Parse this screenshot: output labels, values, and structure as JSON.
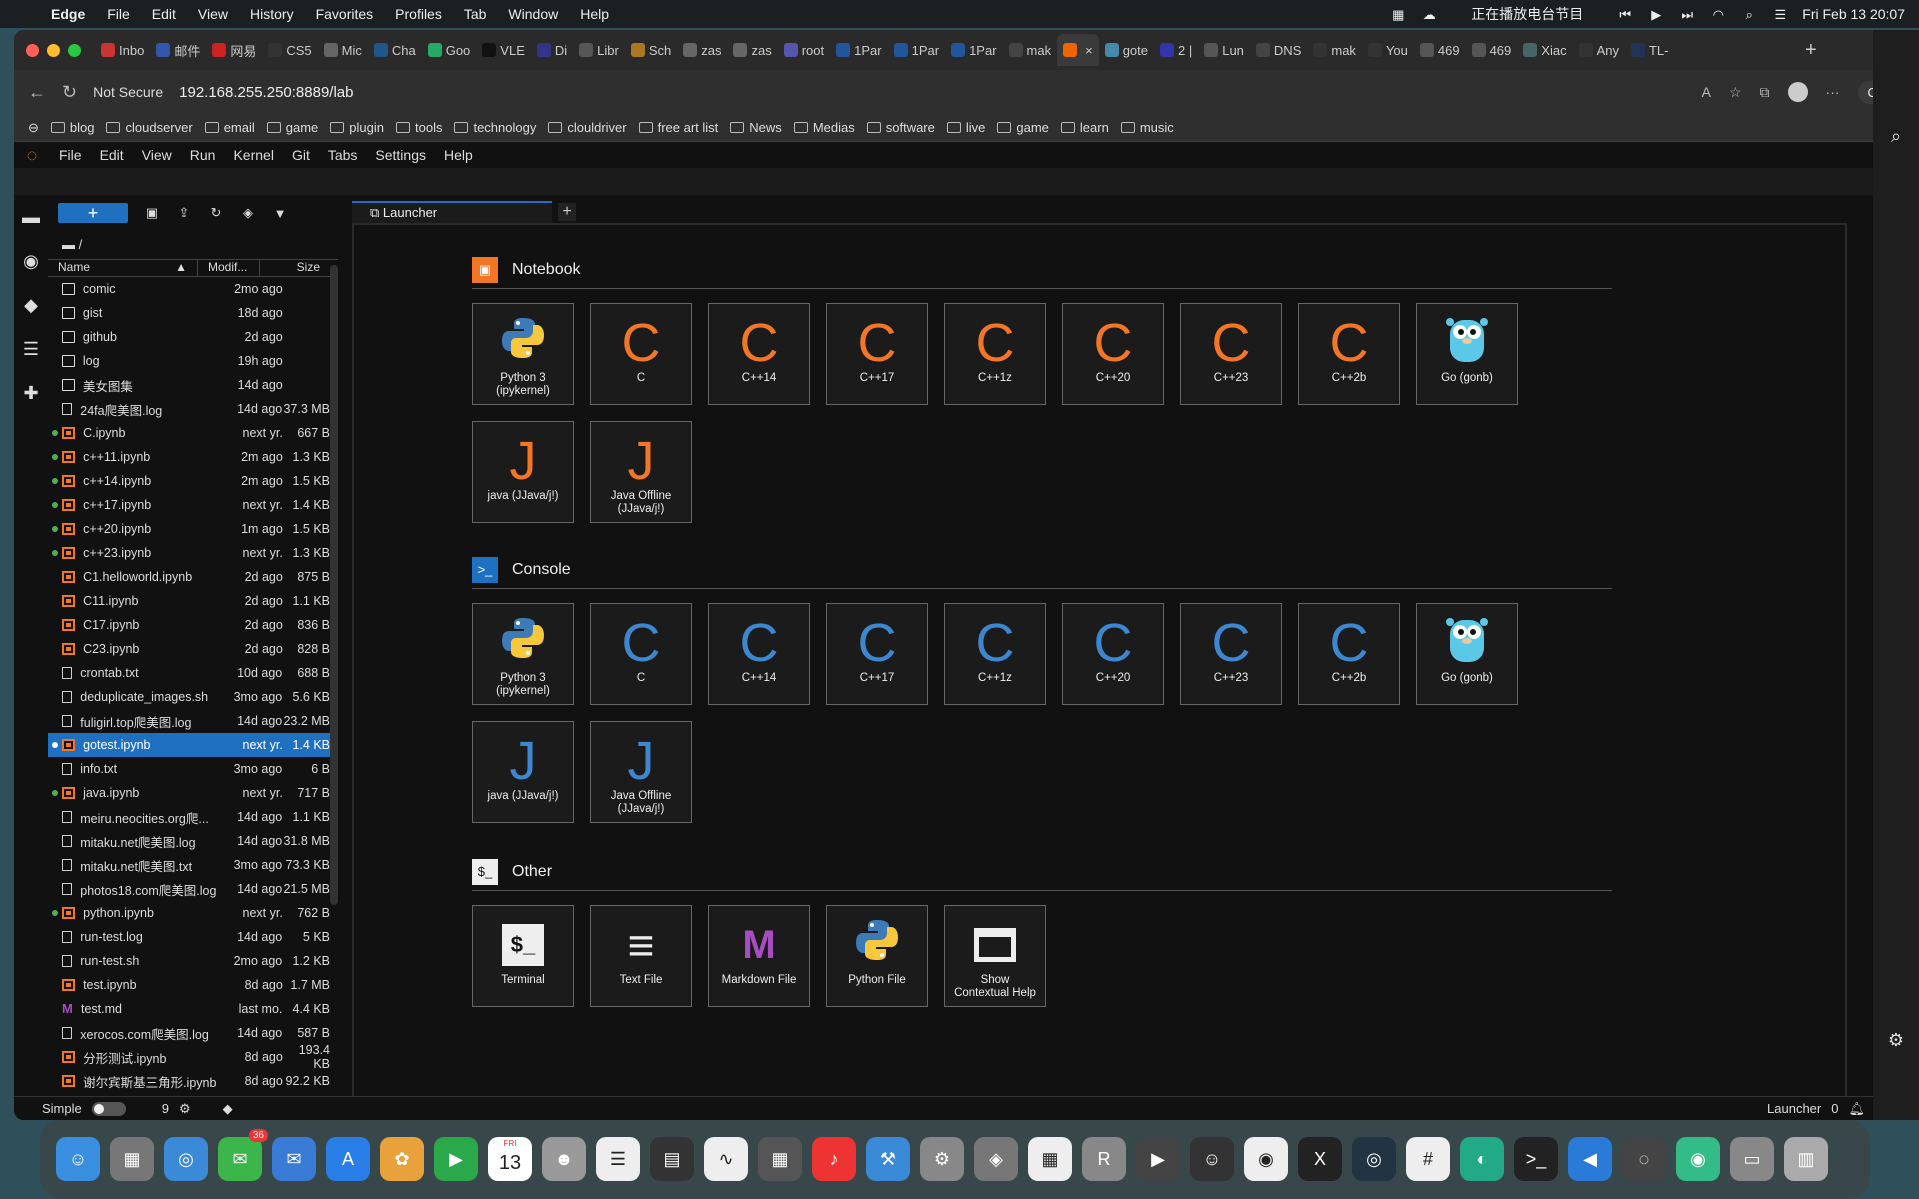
{
  "menubar": {
    "app": "Edge",
    "items": [
      "File",
      "Edit",
      "View",
      "History",
      "Favorites",
      "Profiles",
      "Tab",
      "Window",
      "Help"
    ],
    "now_playing": "正在播放电台节目",
    "datetime": "Fri Feb 13  20:07"
  },
  "browser_tabs": [
    "Inbo",
    "邮件",
    "网易",
    "CS5",
    "Mic",
    "Cha",
    "Goo",
    "VLE",
    "Di",
    "Libr",
    "Sch",
    "zas",
    "zas",
    "root",
    "1Par",
    "1Par",
    "1Par",
    "mak",
    "",
    "gote",
    "2 |",
    "Lun",
    "DNS",
    "mak",
    "You",
    "469",
    "469",
    "Xiac",
    "Any",
    "TL-"
  ],
  "address": {
    "security": "Not Secure",
    "url": "192.168.255.250:8889/lab",
    "chat_label": "Chat"
  },
  "bookmarks": [
    "blog",
    "cloudserver",
    "email",
    "game",
    "plugin",
    "tools",
    "technology",
    "clouldriver",
    "free art list",
    "News",
    "Medias",
    "software",
    "live",
    "game",
    "learn",
    "music"
  ],
  "jupyter_menu": [
    "File",
    "Edit",
    "View",
    "Run",
    "Kernel",
    "Git",
    "Tabs",
    "Settings",
    "Help"
  ],
  "file_browser": {
    "path": "/",
    "columns": {
      "name": "Name",
      "modified": "Modif...",
      "size": "Size"
    },
    "files": [
      {
        "name": "comic",
        "mod": "2mo ago",
        "size": "",
        "type": "folder",
        "running": false
      },
      {
        "name": "gist",
        "mod": "18d ago",
        "size": "",
        "type": "folder",
        "running": false
      },
      {
        "name": "github",
        "mod": "2d ago",
        "size": "",
        "type": "folder",
        "running": false
      },
      {
        "name": "log",
        "mod": "19h ago",
        "size": "",
        "type": "folder",
        "running": false
      },
      {
        "name": "美女图集",
        "mod": "14d ago",
        "size": "",
        "type": "folder",
        "running": false
      },
      {
        "name": "24fa爬美图.log",
        "mod": "14d ago",
        "size": "37.3 MB",
        "type": "doc",
        "running": false
      },
      {
        "name": "C.ipynb",
        "mod": "next yr.",
        "size": "667 B",
        "type": "nb",
        "running": true
      },
      {
        "name": "c++11.ipynb",
        "mod": "2m ago",
        "size": "1.3 KB",
        "type": "nb",
        "running": true
      },
      {
        "name": "c++14.ipynb",
        "mod": "2m ago",
        "size": "1.5 KB",
        "type": "nb",
        "running": true
      },
      {
        "name": "c++17.ipynb",
        "mod": "next yr.",
        "size": "1.4 KB",
        "type": "nb",
        "running": true
      },
      {
        "name": "c++20.ipynb",
        "mod": "1m ago",
        "size": "1.5 KB",
        "type": "nb",
        "running": true
      },
      {
        "name": "c++23.ipynb",
        "mod": "next yr.",
        "size": "1.3 KB",
        "type": "nb",
        "running": true
      },
      {
        "name": "C1.helloworld.ipynb",
        "mod": "2d ago",
        "size": "875 B",
        "type": "nb",
        "running": false
      },
      {
        "name": "C11.ipynb",
        "mod": "2d ago",
        "size": "1.1 KB",
        "type": "nb",
        "running": false
      },
      {
        "name": "C17.ipynb",
        "mod": "2d ago",
        "size": "836 B",
        "type": "nb",
        "running": false
      },
      {
        "name": "C23.ipynb",
        "mod": "2d ago",
        "size": "828 B",
        "type": "nb",
        "running": false
      },
      {
        "name": "crontab.txt",
        "mod": "10d ago",
        "size": "688 B",
        "type": "doc",
        "running": false
      },
      {
        "name": "deduplicate_images.sh",
        "mod": "3mo ago",
        "size": "5.6 KB",
        "type": "doc",
        "running": false
      },
      {
        "name": "fuligirl.top爬美图.log",
        "mod": "14d ago",
        "size": "23.2 MB",
        "type": "doc",
        "running": false
      },
      {
        "name": "gotest.ipynb",
        "mod": "next yr.",
        "size": "1.4 KB",
        "type": "nb",
        "running": true,
        "selected": true
      },
      {
        "name": "info.txt",
        "mod": "3mo ago",
        "size": "6 B",
        "type": "doc",
        "running": false
      },
      {
        "name": "java.ipynb",
        "mod": "next yr.",
        "size": "717 B",
        "type": "nb",
        "running": true
      },
      {
        "name": "meiru.neocities.org爬...",
        "mod": "14d ago",
        "size": "1.1 KB",
        "type": "doc",
        "running": false
      },
      {
        "name": "mitaku.net爬美图.log",
        "mod": "14d ago",
        "size": "31.8 MB",
        "type": "doc",
        "running": false
      },
      {
        "name": "mitaku.net爬美图.txt",
        "mod": "3mo ago",
        "size": "73.3 KB",
        "type": "doc",
        "running": false
      },
      {
        "name": "photos18.com爬美图.log",
        "mod": "14d ago",
        "size": "21.5 MB",
        "type": "doc",
        "running": false
      },
      {
        "name": "python.ipynb",
        "mod": "next yr.",
        "size": "762 B",
        "type": "nb",
        "running": true
      },
      {
        "name": "run-test.log",
        "mod": "14d ago",
        "size": "5 KB",
        "type": "doc",
        "running": false
      },
      {
        "name": "run-test.sh",
        "mod": "2mo ago",
        "size": "1.2 KB",
        "type": "doc",
        "running": false
      },
      {
        "name": "test.ipynb",
        "mod": "8d ago",
        "size": "1.7 MB",
        "type": "nb",
        "running": false
      },
      {
        "name": "test.md",
        "mod": "last mo.",
        "size": "4.4 KB",
        "type": "md",
        "running": false
      },
      {
        "name": "xerocos.com爬美图.log",
        "mod": "14d ago",
        "size": "587 B",
        "type": "doc",
        "running": false
      },
      {
        "name": "分形测试.ipynb",
        "mod": "8d ago",
        "size": "193.4 KB",
        "type": "nb",
        "running": false
      },
      {
        "name": "谢尔宾斯基三角形.ipynb",
        "mod": "8d ago",
        "size": "92.2 KB",
        "type": "nb",
        "running": false
      }
    ]
  },
  "doc_tab": {
    "label": "Launcher"
  },
  "launcher": {
    "notebook": {
      "title": "Notebook",
      "kernels": [
        {
          "glyph": "py",
          "label": "Python 3\n(ipykernel)"
        },
        {
          "glyph": "C",
          "label": "C"
        },
        {
          "glyph": "C",
          "label": "C++14"
        },
        {
          "glyph": "C",
          "label": "C++17"
        },
        {
          "glyph": "C",
          "label": "C++1z"
        },
        {
          "glyph": "C",
          "label": "C++20"
        },
        {
          "glyph": "C",
          "label": "C++23"
        },
        {
          "glyph": "C",
          "label": "C++2b"
        },
        {
          "glyph": "go",
          "label": "Go (gonb)"
        },
        {
          "glyph": "J",
          "label": "java (JJava/j!)"
        },
        {
          "glyph": "J",
          "label": "Java Offline\n(JJava/j!)"
        }
      ]
    },
    "console": {
      "title": "Console",
      "kernels": [
        {
          "glyph": "py",
          "label": "Python 3\n(ipykernel)"
        },
        {
          "glyph": "C",
          "label": "C"
        },
        {
          "glyph": "C",
          "label": "C++14"
        },
        {
          "glyph": "C",
          "label": "C++17"
        },
        {
          "glyph": "C",
          "label": "C++1z"
        },
        {
          "glyph": "C",
          "label": "C++20"
        },
        {
          "glyph": "C",
          "label": "C++23"
        },
        {
          "glyph": "C",
          "label": "C++2b"
        },
        {
          "glyph": "go",
          "label": "Go (gonb)"
        },
        {
          "glyph": "J",
          "label": "java (JJava/j!)"
        },
        {
          "glyph": "J",
          "label": "Java Offline\n(JJava/j!)"
        }
      ]
    },
    "other": {
      "title": "Other",
      "items": [
        {
          "glyph": "$_",
          "label": "Terminal"
        },
        {
          "glyph": "≡",
          "label": "Text File"
        },
        {
          "glyph": "M",
          "label": "Markdown File"
        },
        {
          "glyph": "py",
          "label": "Python File"
        },
        {
          "glyph": "▭",
          "label": "Show\nContextual Help"
        }
      ]
    }
  },
  "status": {
    "mode": "Simple",
    "count": "9",
    "right_label": "Launcher",
    "notifications": "0"
  },
  "dock": {
    "messages_badge": "36",
    "calendar_day": "13",
    "calendar_month": "FRI"
  },
  "colors": {
    "accent": "#1f70c1",
    "jupyter_orange": "#f37626",
    "console_blue": "#3d87d0",
    "running_dot": "#4caf50"
  }
}
